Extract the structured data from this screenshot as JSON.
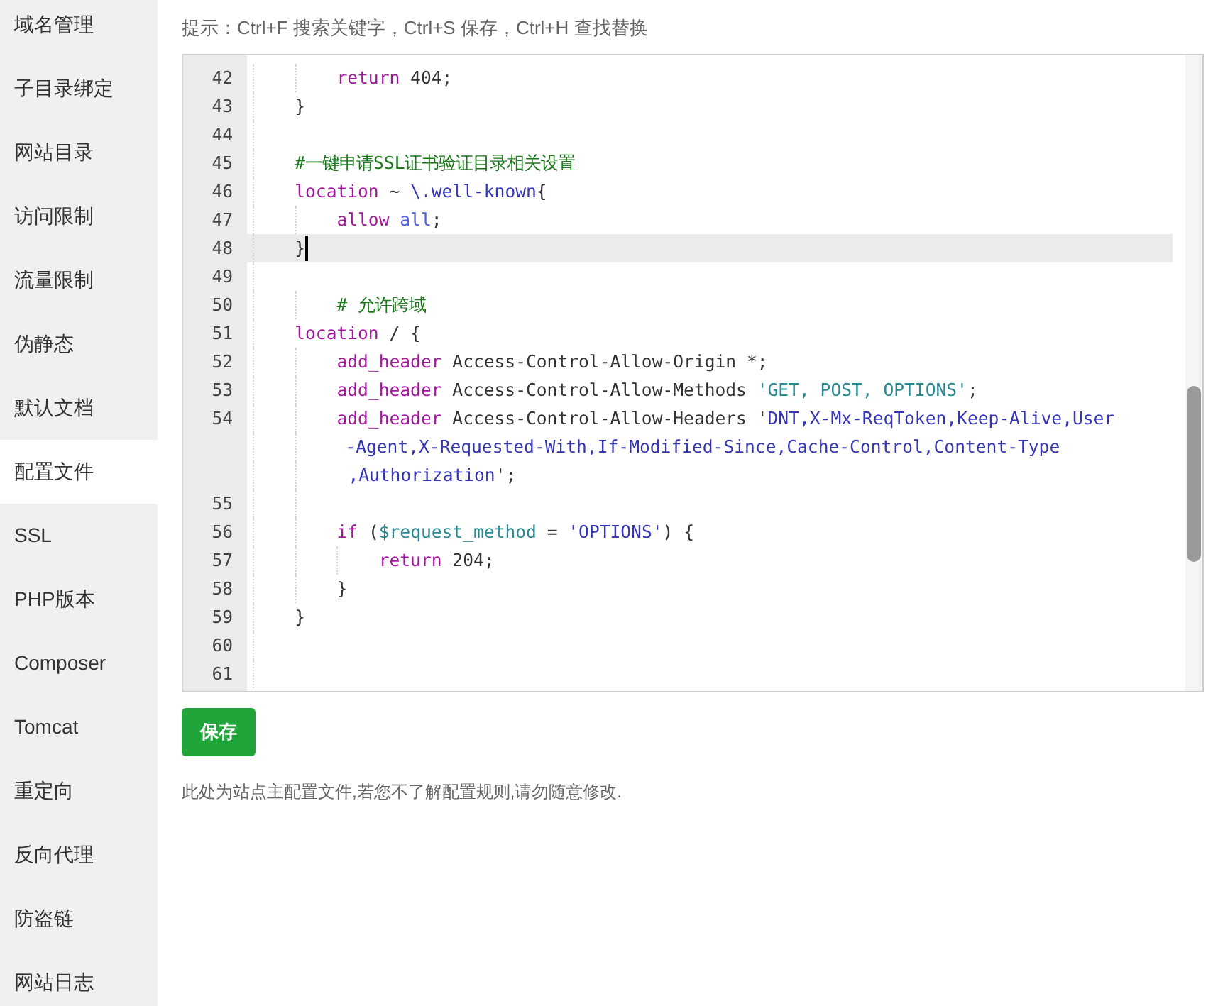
{
  "sidebar": {
    "items": [
      {
        "label": "域名管理",
        "selected": false
      },
      {
        "label": "子目录绑定",
        "selected": false
      },
      {
        "label": "网站目录",
        "selected": false
      },
      {
        "label": "访问限制",
        "selected": false
      },
      {
        "label": "流量限制",
        "selected": false
      },
      {
        "label": "伪静态",
        "selected": false
      },
      {
        "label": "默认文档",
        "selected": false
      },
      {
        "label": "配置文件",
        "selected": true
      },
      {
        "label": "SSL",
        "selected": false
      },
      {
        "label": "PHP版本",
        "selected": false
      },
      {
        "label": "Composer",
        "selected": false
      },
      {
        "label": "Tomcat",
        "selected": false
      },
      {
        "label": "重定向",
        "selected": false
      },
      {
        "label": "反向代理",
        "selected": false
      },
      {
        "label": "防盗链",
        "selected": false
      },
      {
        "label": "网站日志",
        "selected": false
      }
    ]
  },
  "hint": "提示：Ctrl+F 搜索关键字，Ctrl+S 保存，Ctrl+H 查找替换",
  "editor": {
    "lines": [
      {
        "number": "42",
        "active": false,
        "cursor": false,
        "tokens": [
          {
            "kind": "keyword",
            "text": "        return"
          },
          {
            "kind": "plain",
            "text": " 404;"
          }
        ]
      },
      {
        "number": "43",
        "active": false,
        "cursor": false,
        "tokens": [
          {
            "kind": "plain",
            "text": "    }"
          }
        ]
      },
      {
        "number": "44",
        "active": false,
        "cursor": false
      },
      {
        "number": "45",
        "active": false,
        "cursor": false,
        "tokens": [
          {
            "kind": "comment",
            "text": "    #一键申请SSL证书验证目录相关设置"
          }
        ]
      },
      {
        "number": "46",
        "active": false,
        "cursor": false,
        "tokens": [
          {
            "kind": "keyword",
            "text": "    location"
          },
          {
            "kind": "plain",
            "text": " ~ "
          },
          {
            "kind": "string",
            "text": "\\.well-known"
          },
          {
            "kind": "plain",
            "text": "{"
          }
        ]
      },
      {
        "number": "47",
        "active": false,
        "cursor": false,
        "tokens": [
          {
            "kind": "keyword",
            "text": "        allow"
          },
          {
            "kind": "atom",
            "text": " all"
          },
          {
            "kind": "plain",
            "text": ";"
          }
        ]
      },
      {
        "number": "48",
        "active": true,
        "cursor": true,
        "tokens": [
          {
            "kind": "plain",
            "text": "    }"
          }
        ]
      },
      {
        "number": "49",
        "active": false,
        "cursor": false
      },
      {
        "number": "50",
        "active": false,
        "cursor": false,
        "tokens": [
          {
            "kind": "comment",
            "text": "        # 允许跨域"
          }
        ]
      },
      {
        "number": "51",
        "active": false,
        "cursor": false,
        "tokens": [
          {
            "kind": "keyword",
            "text": "    location"
          },
          {
            "kind": "plain",
            "text": " / {"
          }
        ]
      },
      {
        "number": "52",
        "active": false,
        "cursor": false,
        "tokens": [
          {
            "kind": "keyword",
            "text": "        add_header"
          },
          {
            "kind": "plain",
            "text": " Access-Control-Allow-Origin *;"
          }
        ]
      },
      {
        "number": "53",
        "active": false,
        "cursor": false,
        "tokens": [
          {
            "kind": "keyword",
            "text": "        add_header"
          },
          {
            "kind": "plain",
            "text": " Access-Control-Allow-Methods "
          },
          {
            "kind": "variable",
            "text": "'GET, POST, OPTIONS'"
          },
          {
            "kind": "plain",
            "text": ";"
          }
        ]
      },
      {
        "number": "54",
        "active": false,
        "cursor": false,
        "tokens": [
          {
            "kind": "keyword",
            "text": "        add_header"
          },
          {
            "kind": "plain",
            "text": " Access-Control-Allow-Headers '"
          },
          {
            "kind": "string",
            "text": "DNT,X-Mx-ReqToken,Keep-Alive,User"
          }
        ],
        "wraps": [
          [
            {
              "kind": "string",
              "text": "-Agent,X-Requested-With,If-Modified-Since,Cache-Control,Content-Type"
            }
          ],
          [
            {
              "kind": "string",
              "text": ",Authorization"
            },
            {
              "kind": "plain",
              "text": "';"
            }
          ]
        ]
      },
      {
        "number": "55",
        "active": false,
        "cursor": false
      },
      {
        "number": "56",
        "active": false,
        "cursor": false,
        "tokens": [
          {
            "kind": "keyword",
            "text": "        if"
          },
          {
            "kind": "plain",
            "text": " ("
          },
          {
            "kind": "variable",
            "text": "$request_method"
          },
          {
            "kind": "plain",
            "text": " = "
          },
          {
            "kind": "string",
            "text": "'OPTIONS'"
          },
          {
            "kind": "plain",
            "text": ") {"
          }
        ]
      },
      {
        "number": "57",
        "active": false,
        "cursor": false,
        "tokens": [
          {
            "kind": "keyword",
            "text": "            return"
          },
          {
            "kind": "plain",
            "text": " 204;"
          }
        ]
      },
      {
        "number": "58",
        "active": false,
        "cursor": false,
        "tokens": [
          {
            "kind": "plain",
            "text": "        }"
          }
        ]
      },
      {
        "number": "59",
        "active": false,
        "cursor": false,
        "tokens": [
          {
            "kind": "plain",
            "text": "    }"
          }
        ]
      },
      {
        "number": "60",
        "active": false,
        "cursor": false
      },
      {
        "number": "61",
        "active": false,
        "cursor": false
      }
    ]
  },
  "save_button": "保存",
  "note": "此处为站点主配置文件,若您不了解配置规则,请勿随意修改."
}
